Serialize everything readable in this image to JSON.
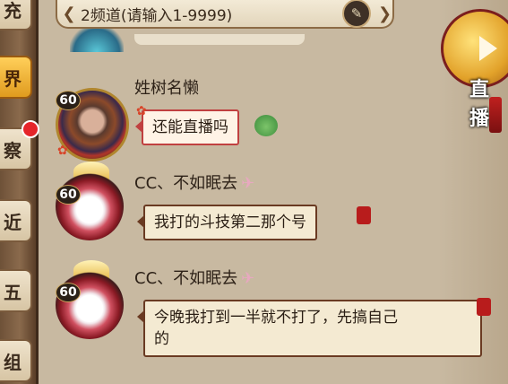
{
  "tabs": [
    {
      "label": "充",
      "active": false
    },
    {
      "label": "界",
      "active": true
    },
    {
      "label": "察",
      "active": false
    },
    {
      "label": "近",
      "active": false
    },
    {
      "label": "五",
      "active": false
    },
    {
      "label": "组",
      "active": false
    }
  ],
  "channel": {
    "label": "2频道(请输入1-9999)"
  },
  "live_button": {
    "label": "直播"
  },
  "messages": [
    {
      "name": "姓树名懒",
      "level": "60",
      "text": "还能直播吗"
    },
    {
      "name": "CC、不如眠去",
      "level": "60",
      "text": "我打的斗技第二那个号"
    },
    {
      "name": "CC、不如眠去",
      "level": "60",
      "text_line1": "今晚我打到一半就不打了，先搞自己",
      "text_line2": "的"
    }
  ],
  "colors": {
    "accent": "#e09b1e",
    "bubble_border": "#6a3a22",
    "badge": "#e5252a"
  }
}
